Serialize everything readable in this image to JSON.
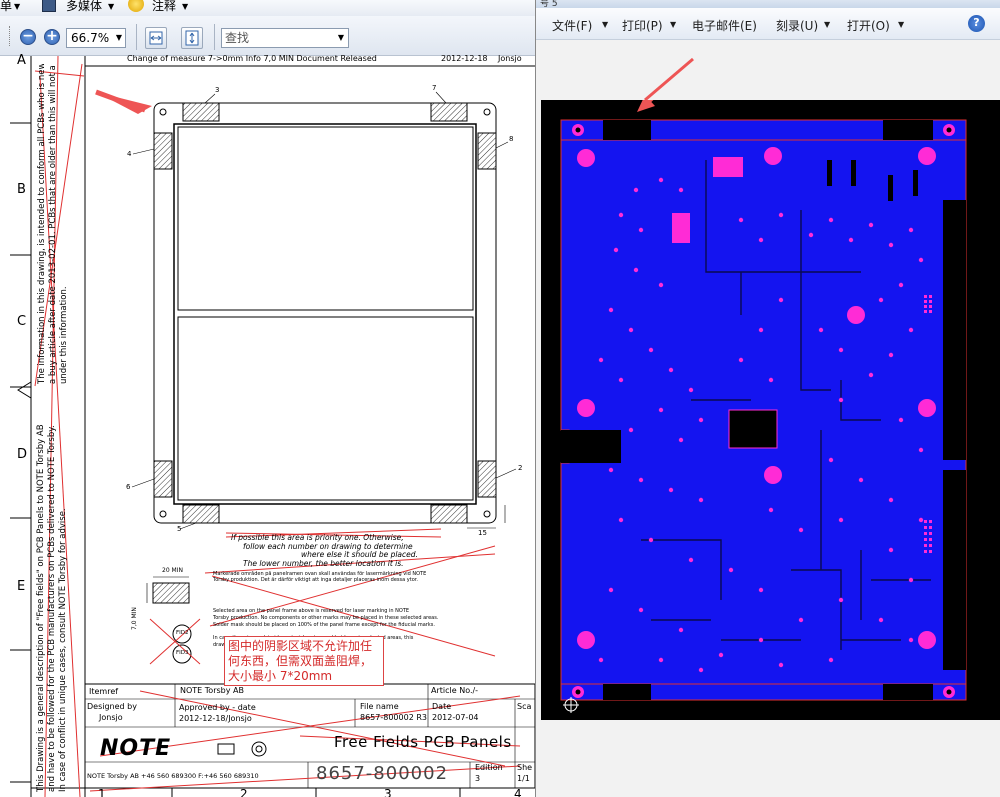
{
  "left_viewer": {
    "menu": [
      "单",
      "多媒体",
      "注释"
    ],
    "zoom_value": "66.7%",
    "find_placeholder": "查找"
  },
  "drawing": {
    "row_letters": [
      "A",
      "B",
      "C",
      "D",
      "E"
    ],
    "column_numbers": [
      "1",
      "2",
      "3",
      "4"
    ],
    "revision_text": "Change of measure 7->0mm Info  7,0 MIN  Document Released",
    "revision_date": "2012-12-18",
    "revision_by": "Jonsjo",
    "corner_labels": [
      "3",
      "7",
      "4",
      "8",
      "6",
      "2",
      "5"
    ],
    "dimension_15": "15",
    "dimension_20min": "20 MIN",
    "dimension_7min": "7,0 MIN",
    "priority_text": [
      "If possible this area is priority one. Otherwise,",
      "follow each number on drawing to determine",
      "where else it should be placed.",
      "The lower number, the better location it is."
    ],
    "swedish_text": [
      "Markerade områden på panelramen ovan skall användas för lasermärkning vid NOTE",
      "Torsby produktion. Det är därför viktigt att inga detaljer placeras inom dessa ytor."
    ],
    "english_text": [
      "Selected area on the panel frame above is reserved for laser marking in NOTE",
      "Torsby production. No components or other marks may be placed in these selected areas.",
      "Solder mask should be placed on 100% of the panel frame except for the fiducial marks.",
      "In case there is a polyimide material on top and bot layer in selected areas, this",
      "drawing does not apply."
    ],
    "fiducial_labels": [
      "FID2",
      "FID3"
    ],
    "annotation_note": "图中的阴影区域不允许加任何东西，但需双面盖阻焊，大小最小 7*20mm",
    "side_text": [
      "This Drawing is a general description of \"Free fields\" on PCB Panels to NOTE Torsby AB",
      "and have to be followed for the PCB manufacturers on PCBs delivered to NOTE Torsby.",
      "In case of conflict in unique cases, consult NOTE Torsby for advise."
    ],
    "side_text_2": [
      "The information in this drawing, is intended to conform all PCBs who is newly",
      "ordered, or on PCBs that are older than this will not be",
      "a buy article after date 2013-02-01. PCBs that are older than this will not a",
      "under this information."
    ],
    "title_block": {
      "itemref_label": "Itemref",
      "company": "NOTE Torsby AB",
      "article_label": "Article No./-",
      "designed_label": "Designed by",
      "designed_value": "Jonsjo",
      "approved_label": "Approved by - date",
      "approved_value": "2012-12-18/Jonsjo",
      "filename_label": "File name",
      "filename_value": "8657-800002 R3",
      "date_label": "Date",
      "date_value": "2012-07-04",
      "scale_label": "Sca",
      "logo": "NOTE",
      "contact": "NOTE Torsby AB +46 560 689300 F:+46 560 689310",
      "title": "Free Fields PCB Panels",
      "doc_number": "8657-800002",
      "edition_label": "Edition",
      "edition_value": "3",
      "sheet_label": "She",
      "sheet_value": "1/1"
    }
  },
  "right_window": {
    "title_fragment": "号 5",
    "toolbar": [
      "文件(F)",
      "打印(P)",
      "电子邮件(E)",
      "刻录(U)",
      "打开(O)"
    ],
    "help": "?"
  },
  "colors": {
    "annotation_red": "#e03030",
    "pcb_blue": "#1414f0",
    "pcb_magenta": "#ff2bd6"
  }
}
